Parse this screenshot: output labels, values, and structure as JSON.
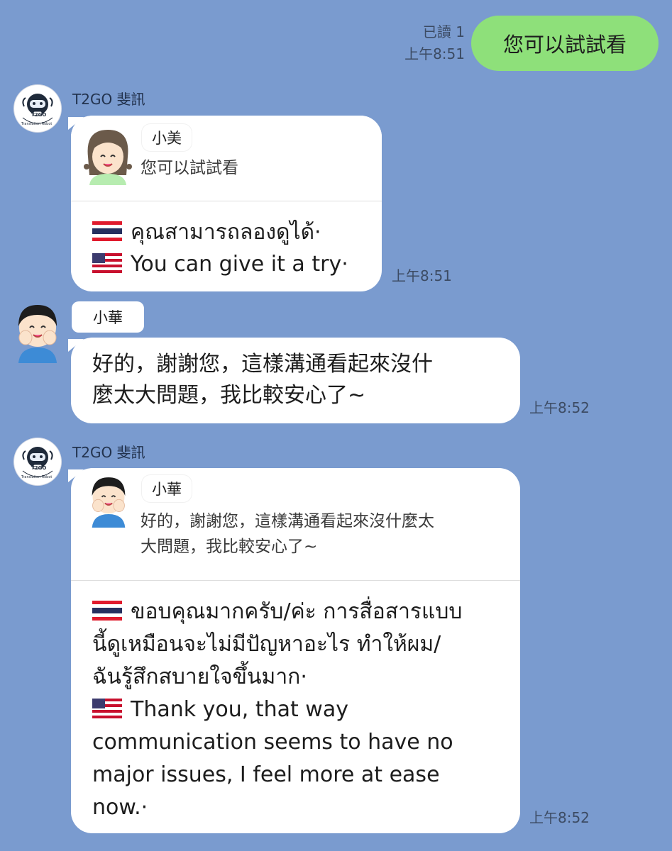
{
  "outgoing": {
    "read_status": "已讀 1",
    "time": "上午8:51",
    "text": "您可以試試看"
  },
  "msg1": {
    "sender": "T2GO 斐訊",
    "bot_badge": "T2GO",
    "bot_subtitle": "Translation Robot",
    "quote_name": "小美",
    "quote_text": "您可以試試看",
    "thai": "คุณสามารถลองดูได้·",
    "english": "You can give it a try·",
    "time": "上午8:51"
  },
  "msg2": {
    "sender": "小華",
    "line1": "好的，謝謝您，這樣溝通看起來沒什",
    "line2": "麼太大問題，我比較安心了~",
    "time": "上午8:52"
  },
  "msg3": {
    "sender": "T2GO 斐訊",
    "bot_badge": "T2GO",
    "bot_subtitle": "Translation Robot",
    "quote_name": "小華",
    "quote_line1": "好的，謝謝您，這樣溝通看起來沒什麼太",
    "quote_line2": "大問題，我比較安心了~",
    "thai_line1": "ขอบคุณมากครับ/ค่ะ การสื่อสารแบบ",
    "thai_line2": "นี้ดูเหมือนจะไม่มีปัญหาอะไร ทำให้ผม/",
    "thai_line3": "ฉันรู้สึกสบายใจขึ้นมาก·",
    "en_line1": "Thank you, that way",
    "en_line2": "communication seems to have no",
    "en_line3": "major issues, I feel more at ease",
    "en_line4": "now.·",
    "time": "上午8:52"
  },
  "colors": {
    "background": "#7a9bcf",
    "outgoing_bubble": "#8ee07a",
    "incoming_bubble": "#ffffff"
  },
  "icons": [
    "t2go-robot-avatar",
    "girl-avatar",
    "boy-avatar",
    "thai-flag-icon",
    "us-flag-icon"
  ]
}
